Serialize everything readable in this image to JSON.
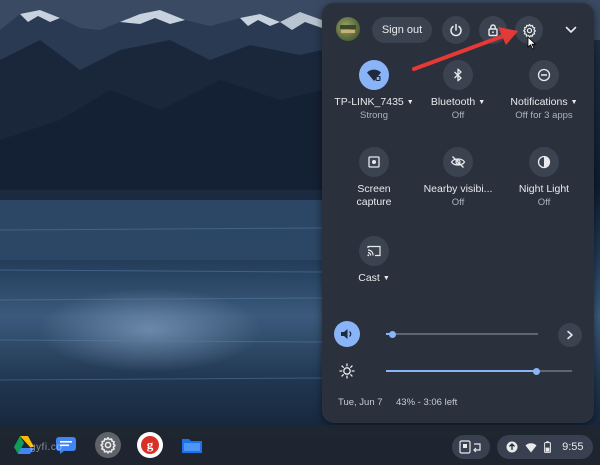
{
  "colors": {
    "panel_bg": "#2a303c",
    "button_bg": "#3c4350",
    "accent": "#8ab4f8",
    "annotation_arrow": "#e53935"
  },
  "header": {
    "sign_out_label": "Sign out",
    "icons": [
      "avatar",
      "power-icon",
      "lock-icon",
      "settings-gear-icon",
      "chevron-down-icon"
    ]
  },
  "tiles": {
    "wifi": {
      "label": "TP-LINK_7435",
      "sub": "Strong",
      "icon": "wifi-icon",
      "active": true
    },
    "bluetooth": {
      "label": "Bluetooth",
      "sub": "Off",
      "icon": "bluetooth-icon"
    },
    "notifications": {
      "label": "Notifications",
      "sub": "Off for 3 apps",
      "icon": "do-not-disturb-icon"
    },
    "screen_capture": {
      "label": "Screen",
      "label2": "capture",
      "icon": "screen-capture-icon"
    },
    "nearby": {
      "label": "Nearby visibi...",
      "sub": "Off",
      "icon": "nearby-share-icon"
    },
    "night_light": {
      "label": "Night Light",
      "sub": "Off",
      "icon": "night-light-icon"
    },
    "cast": {
      "label": "Cast",
      "icon": "cast-icon"
    }
  },
  "sliders": {
    "volume_level": 0.04,
    "brightness_level": 0.81
  },
  "footer": {
    "date": "Tue, Jun 7",
    "battery": "43% - 3:06 left"
  },
  "shelf": {
    "apps": [
      "google-drive-icon",
      "messages-icon",
      "settings-icon",
      "google-icon",
      "files-icon"
    ],
    "watermark": "gyfi.co",
    "time": "9:55"
  }
}
